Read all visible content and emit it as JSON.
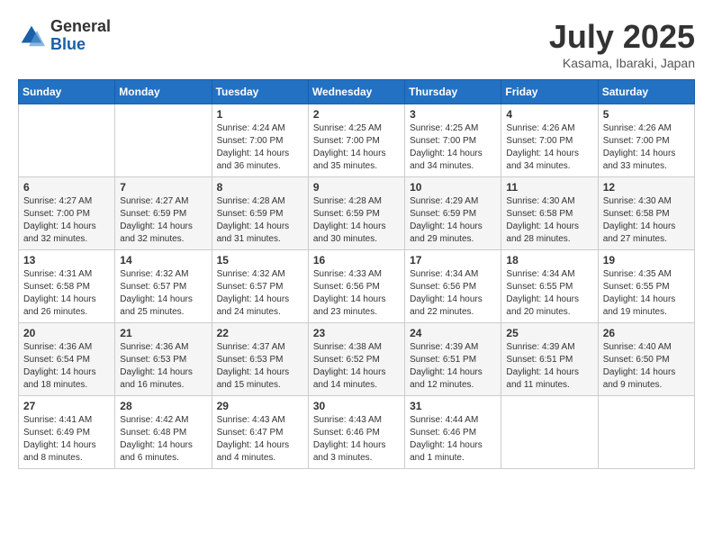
{
  "logo": {
    "general": "General",
    "blue": "Blue"
  },
  "title": "July 2025",
  "location": "Kasama, Ibaraki, Japan",
  "weekdays": [
    "Sunday",
    "Monday",
    "Tuesday",
    "Wednesday",
    "Thursday",
    "Friday",
    "Saturday"
  ],
  "weeks": [
    [
      {
        "day": "",
        "sunrise": "",
        "sunset": "",
        "daylight": ""
      },
      {
        "day": "",
        "sunrise": "",
        "sunset": "",
        "daylight": ""
      },
      {
        "day": "1",
        "sunrise": "Sunrise: 4:24 AM",
        "sunset": "Sunset: 7:00 PM",
        "daylight": "Daylight: 14 hours and 36 minutes."
      },
      {
        "day": "2",
        "sunrise": "Sunrise: 4:25 AM",
        "sunset": "Sunset: 7:00 PM",
        "daylight": "Daylight: 14 hours and 35 minutes."
      },
      {
        "day": "3",
        "sunrise": "Sunrise: 4:25 AM",
        "sunset": "Sunset: 7:00 PM",
        "daylight": "Daylight: 14 hours and 34 minutes."
      },
      {
        "day": "4",
        "sunrise": "Sunrise: 4:26 AM",
        "sunset": "Sunset: 7:00 PM",
        "daylight": "Daylight: 14 hours and 34 minutes."
      },
      {
        "day": "5",
        "sunrise": "Sunrise: 4:26 AM",
        "sunset": "Sunset: 7:00 PM",
        "daylight": "Daylight: 14 hours and 33 minutes."
      }
    ],
    [
      {
        "day": "6",
        "sunrise": "Sunrise: 4:27 AM",
        "sunset": "Sunset: 7:00 PM",
        "daylight": "Daylight: 14 hours and 32 minutes."
      },
      {
        "day": "7",
        "sunrise": "Sunrise: 4:27 AM",
        "sunset": "Sunset: 6:59 PM",
        "daylight": "Daylight: 14 hours and 32 minutes."
      },
      {
        "day": "8",
        "sunrise": "Sunrise: 4:28 AM",
        "sunset": "Sunset: 6:59 PM",
        "daylight": "Daylight: 14 hours and 31 minutes."
      },
      {
        "day": "9",
        "sunrise": "Sunrise: 4:28 AM",
        "sunset": "Sunset: 6:59 PM",
        "daylight": "Daylight: 14 hours and 30 minutes."
      },
      {
        "day": "10",
        "sunrise": "Sunrise: 4:29 AM",
        "sunset": "Sunset: 6:59 PM",
        "daylight": "Daylight: 14 hours and 29 minutes."
      },
      {
        "day": "11",
        "sunrise": "Sunrise: 4:30 AM",
        "sunset": "Sunset: 6:58 PM",
        "daylight": "Daylight: 14 hours and 28 minutes."
      },
      {
        "day": "12",
        "sunrise": "Sunrise: 4:30 AM",
        "sunset": "Sunset: 6:58 PM",
        "daylight": "Daylight: 14 hours and 27 minutes."
      }
    ],
    [
      {
        "day": "13",
        "sunrise": "Sunrise: 4:31 AM",
        "sunset": "Sunset: 6:58 PM",
        "daylight": "Daylight: 14 hours and 26 minutes."
      },
      {
        "day": "14",
        "sunrise": "Sunrise: 4:32 AM",
        "sunset": "Sunset: 6:57 PM",
        "daylight": "Daylight: 14 hours and 25 minutes."
      },
      {
        "day": "15",
        "sunrise": "Sunrise: 4:32 AM",
        "sunset": "Sunset: 6:57 PM",
        "daylight": "Daylight: 14 hours and 24 minutes."
      },
      {
        "day": "16",
        "sunrise": "Sunrise: 4:33 AM",
        "sunset": "Sunset: 6:56 PM",
        "daylight": "Daylight: 14 hours and 23 minutes."
      },
      {
        "day": "17",
        "sunrise": "Sunrise: 4:34 AM",
        "sunset": "Sunset: 6:56 PM",
        "daylight": "Daylight: 14 hours and 22 minutes."
      },
      {
        "day": "18",
        "sunrise": "Sunrise: 4:34 AM",
        "sunset": "Sunset: 6:55 PM",
        "daylight": "Daylight: 14 hours and 20 minutes."
      },
      {
        "day": "19",
        "sunrise": "Sunrise: 4:35 AM",
        "sunset": "Sunset: 6:55 PM",
        "daylight": "Daylight: 14 hours and 19 minutes."
      }
    ],
    [
      {
        "day": "20",
        "sunrise": "Sunrise: 4:36 AM",
        "sunset": "Sunset: 6:54 PM",
        "daylight": "Daylight: 14 hours and 18 minutes."
      },
      {
        "day": "21",
        "sunrise": "Sunrise: 4:36 AM",
        "sunset": "Sunset: 6:53 PM",
        "daylight": "Daylight: 14 hours and 16 minutes."
      },
      {
        "day": "22",
        "sunrise": "Sunrise: 4:37 AM",
        "sunset": "Sunset: 6:53 PM",
        "daylight": "Daylight: 14 hours and 15 minutes."
      },
      {
        "day": "23",
        "sunrise": "Sunrise: 4:38 AM",
        "sunset": "Sunset: 6:52 PM",
        "daylight": "Daylight: 14 hours and 14 minutes."
      },
      {
        "day": "24",
        "sunrise": "Sunrise: 4:39 AM",
        "sunset": "Sunset: 6:51 PM",
        "daylight": "Daylight: 14 hours and 12 minutes."
      },
      {
        "day": "25",
        "sunrise": "Sunrise: 4:39 AM",
        "sunset": "Sunset: 6:51 PM",
        "daylight": "Daylight: 14 hours and 11 minutes."
      },
      {
        "day": "26",
        "sunrise": "Sunrise: 4:40 AM",
        "sunset": "Sunset: 6:50 PM",
        "daylight": "Daylight: 14 hours and 9 minutes."
      }
    ],
    [
      {
        "day": "27",
        "sunrise": "Sunrise: 4:41 AM",
        "sunset": "Sunset: 6:49 PM",
        "daylight": "Daylight: 14 hours and 8 minutes."
      },
      {
        "day": "28",
        "sunrise": "Sunrise: 4:42 AM",
        "sunset": "Sunset: 6:48 PM",
        "daylight": "Daylight: 14 hours and 6 minutes."
      },
      {
        "day": "29",
        "sunrise": "Sunrise: 4:43 AM",
        "sunset": "Sunset: 6:47 PM",
        "daylight": "Daylight: 14 hours and 4 minutes."
      },
      {
        "day": "30",
        "sunrise": "Sunrise: 4:43 AM",
        "sunset": "Sunset: 6:46 PM",
        "daylight": "Daylight: 14 hours and 3 minutes."
      },
      {
        "day": "31",
        "sunrise": "Sunrise: 4:44 AM",
        "sunset": "Sunset: 6:46 PM",
        "daylight": "Daylight: 14 hours and 1 minute."
      },
      {
        "day": "",
        "sunrise": "",
        "sunset": "",
        "daylight": ""
      },
      {
        "day": "",
        "sunrise": "",
        "sunset": "",
        "daylight": ""
      }
    ]
  ]
}
